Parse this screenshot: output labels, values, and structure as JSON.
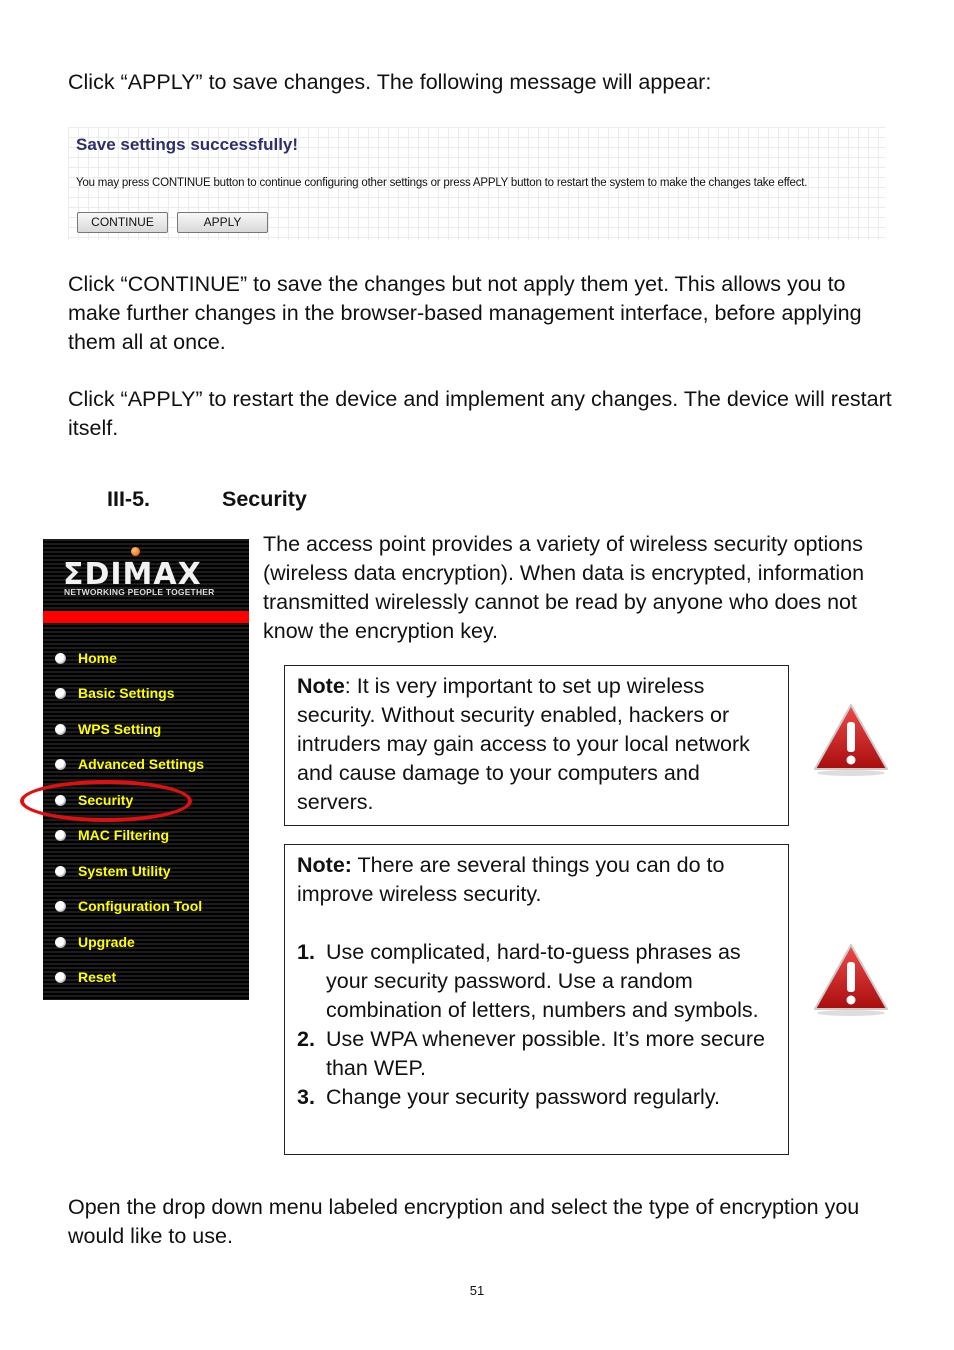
{
  "intro": "Click “APPLY” to save changes. The following message will appear:",
  "dialog": {
    "title": "Save settings successfully!",
    "message": "You may press CONTINUE button to continue configuring other settings or press APPLY button to restart the system to make the changes take effect.",
    "continue_label": "CONTINUE",
    "apply_label": "APPLY"
  },
  "para_continue": "Click “CONTINUE” to save the changes but not apply them yet. This allows you to make further changes in the browser-based management interface, before applying them all at once.",
  "para_apply": "Click “APPLY” to restart the device and implement any changes. The device will restart itself.",
  "section": {
    "number": "III-5.",
    "title": "Security"
  },
  "section_intro": "The access point provides a variety of wireless security options (wireless data encryption). When data is encrypted, information transmitted wirelessly cannot be read by anyone who does not know the encryption key.",
  "edimax": {
    "logo": "ΣDIMAX",
    "tagline": "NETWORKING PEOPLE TOGETHER",
    "menu": [
      {
        "label": "Home"
      },
      {
        "label": "Basic Settings"
      },
      {
        "label": "WPS Setting"
      },
      {
        "label": "Advanced Settings"
      },
      {
        "label": "Security"
      },
      {
        "label": "MAC Filtering"
      },
      {
        "label": "System Utility"
      },
      {
        "label": "Configuration Tool"
      },
      {
        "label": "Upgrade"
      },
      {
        "label": "Reset"
      }
    ],
    "highlighted": "Security"
  },
  "note1": {
    "label": "Note",
    "text": ": It is very important to set up wireless security. Without security enabled, hackers or intruders may gain access to your local network and cause damage to your computers and servers."
  },
  "note2": {
    "label": "Note:",
    "text": " There are several things you can do to improve wireless security.",
    "items": [
      {
        "num": "1.",
        "text": "Use complicated, hard-to-guess phrases as your security password. Use a random combination of letters, numbers and symbols."
      },
      {
        "num": "2.",
        "text": "Use WPA whenever possible. It’s more secure than WEP."
      },
      {
        "num": "3.",
        "text": "Change your security password regularly."
      }
    ]
  },
  "outro": "Open the drop down menu labeled encryption and select the type of encryption you would like to use.",
  "page_number": "51",
  "icons": {
    "warning": "warning-triangle-icon"
  },
  "colors": {
    "menu_text": "#ffff00",
    "brand_red": "#ff0000",
    "highlight": "#e01010",
    "dialog_title": "#2b2f6b"
  }
}
